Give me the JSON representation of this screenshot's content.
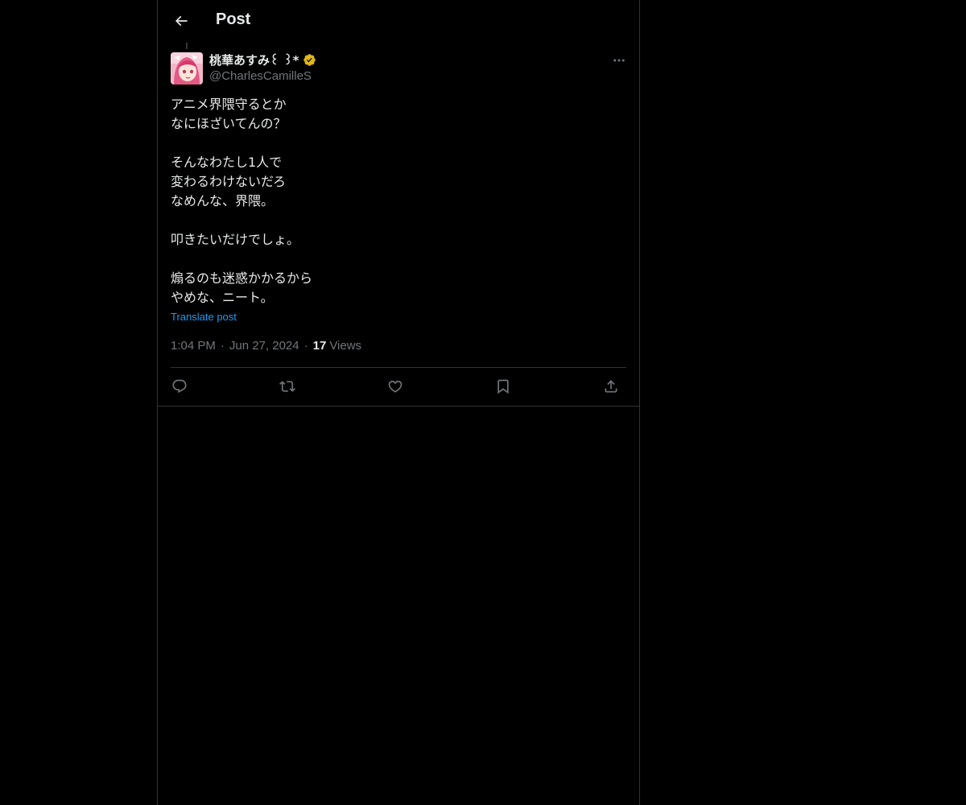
{
  "header": {
    "title": "Post",
    "back_icon": "arrow-left-icon"
  },
  "post": {
    "author": {
      "display_name": "桃華あすみ꒰ ꒱*",
      "handle": "@CharlesCamilleS",
      "verified": true,
      "verified_color": "#f4b400"
    },
    "text": "アニメ界隈守るとか\nなにほざいてんの？\n\nそんなわたし1人で\n変わるわけないだろ\nなめんな、界隈。\n\n叩きたいだけでしょ。\n\n煽るのも迷惑かかるから\nやめな、ニート。",
    "translate_label": "Translate post",
    "time": "1:04 PM",
    "date": "Jun 27, 2024",
    "views_count": "17",
    "views_label": "Views"
  },
  "actions": [
    {
      "name": "reply",
      "icon": "reply-icon"
    },
    {
      "name": "repost",
      "icon": "repost-icon"
    },
    {
      "name": "like",
      "icon": "heart-icon"
    },
    {
      "name": "bookmark",
      "icon": "bookmark-icon"
    },
    {
      "name": "share",
      "icon": "share-icon"
    }
  ],
  "colors": {
    "background": "#000000",
    "text": "#e7e9ea",
    "secondary": "#71767b",
    "border": "#2f3336",
    "link": "#1d9bf0"
  }
}
